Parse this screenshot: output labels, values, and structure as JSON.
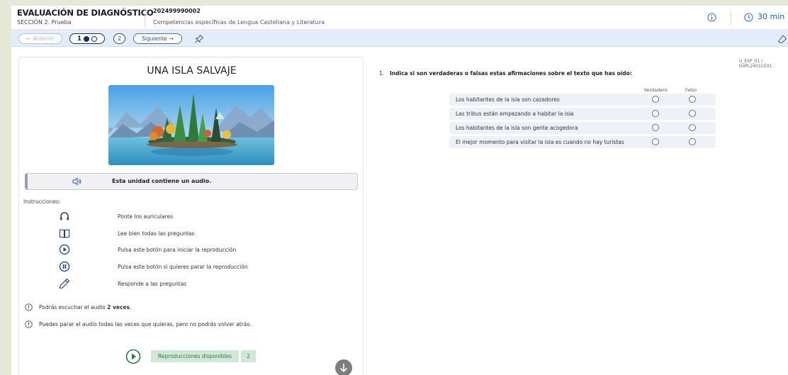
{
  "header": {
    "title": "EVALUACIÓN DE DIAGNÓSTICO",
    "section": "SECCIÓN 2. Prueba",
    "code": "202499990002",
    "competence": "Competencias específicas de Lengua Castellana y Literatura",
    "timer": "30 min"
  },
  "nav": {
    "prev_label": "Anterior",
    "step1_label": "1",
    "step2_label": "2",
    "next_label": "Siguiente"
  },
  "reference": "U_ESP_01 / D4PL2401CEX1",
  "story": {
    "title": "UNA ISLA SALVAJE",
    "audio_notice": "Esta unidad contiene un audio.",
    "instructions_heading": "Instrucciones:",
    "instructions": [
      {
        "icon": "headphones-icon",
        "text": "Ponte los auriculares"
      },
      {
        "icon": "book-icon",
        "text": "Lee bien todas las preguntas"
      },
      {
        "icon": "play-circle-icon",
        "text": "Pulsa este botón para iniciar la reproducción"
      },
      {
        "icon": "pause-circle-icon",
        "text": "Pulsa este botón si quieres parar la reproducción"
      },
      {
        "icon": "pencil-icon",
        "text": "Responde a las preguntas"
      }
    ],
    "note1_prefix": "Podrás escuchar el audio ",
    "note1_bold": "2 veces",
    "note1_suffix": ".",
    "note2": "Puedes parar el audio todas las veces que quieras, pero no podrás volver atrás.",
    "plays_label": "Reproducciones disponibles",
    "plays_count": "2"
  },
  "question": {
    "number": "1.",
    "text": "Indica si son verdaderas o falsas estas afirmaciones sobre el texto que has oído:",
    "col_true": "Verdadero",
    "col_false": "Falso",
    "statements": [
      "Los habitantes de la isla son cazadores",
      "Las tribus están empezando a habitar la isla",
      "Los habitantes de la isla son gente acogedora",
      "El mejor momento para visitar la isla es cuando no hay turistas"
    ]
  },
  "colors": {
    "accent": "#1e63c4",
    "nav_bg": "#e3ecf9",
    "play_green": "#2f7a48",
    "badge_green": "#d3e7d8"
  }
}
